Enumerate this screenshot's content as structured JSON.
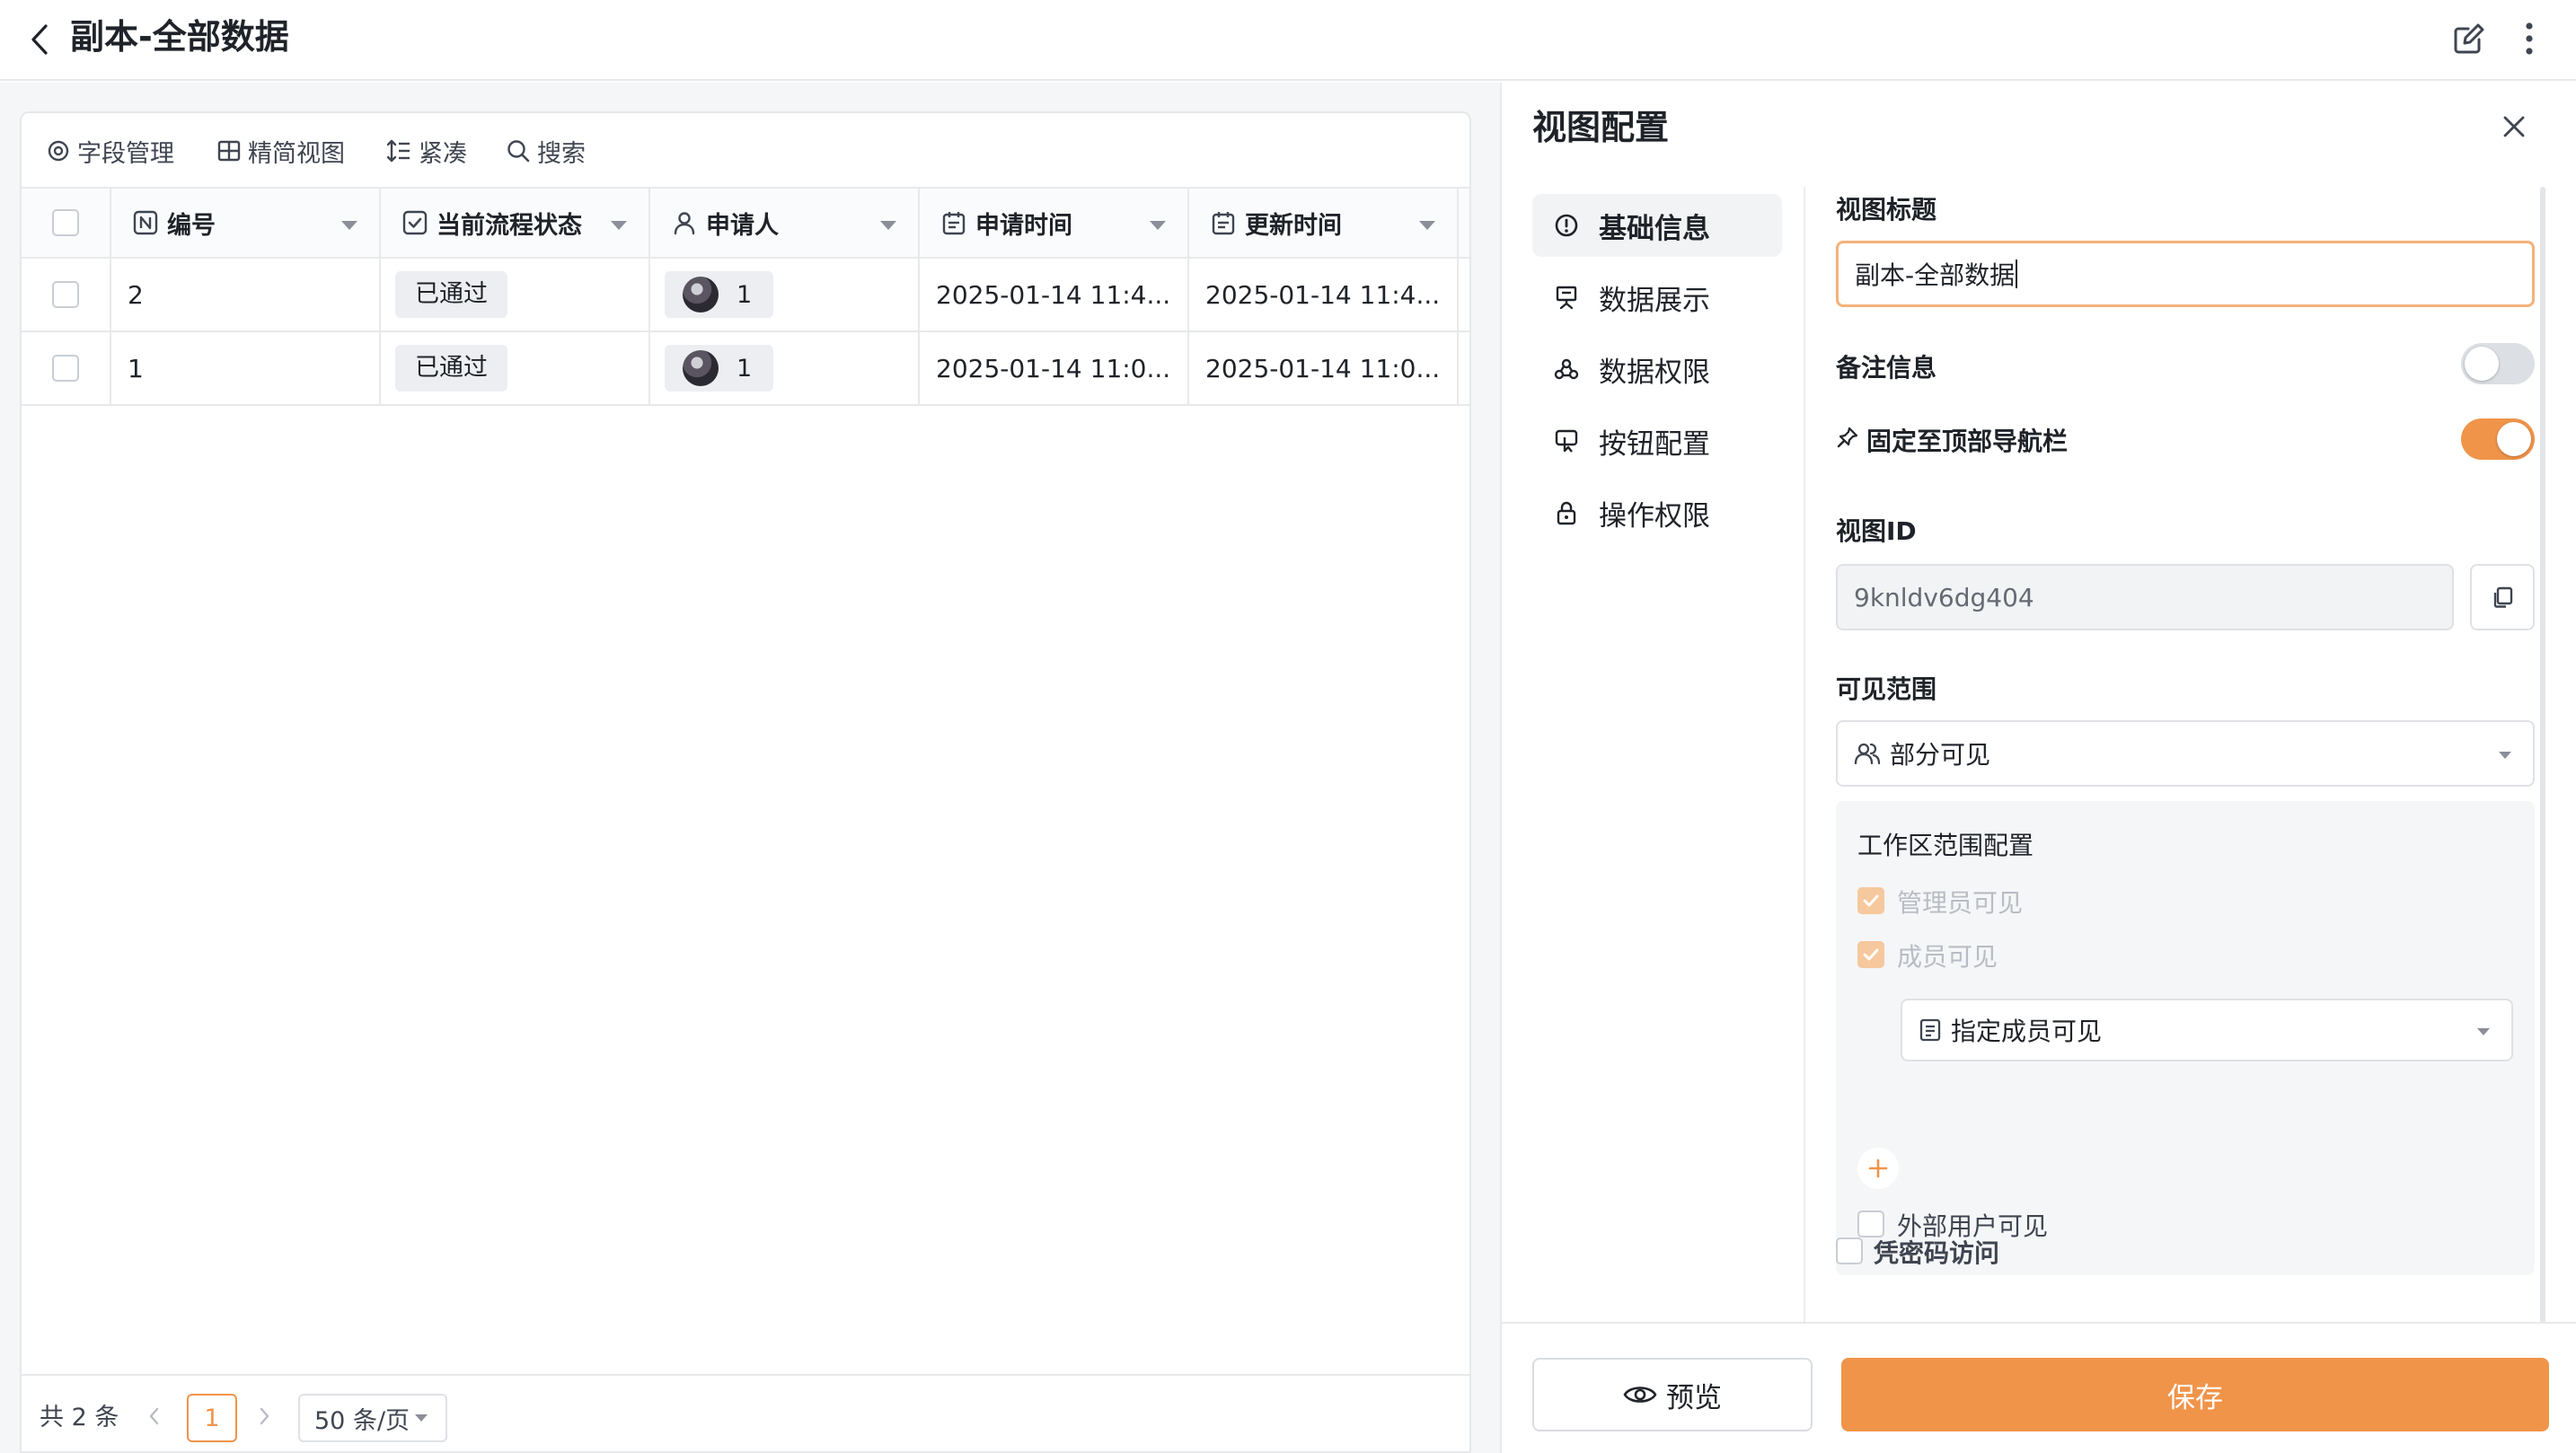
{
  "header": {
    "title": "副本-全部数据"
  },
  "toolbar": {
    "fields": "字段管理",
    "compact_view": "精简视图",
    "density": "紧凑",
    "search": "搜索"
  },
  "table": {
    "columns": [
      {
        "label": "编号",
        "icon": "number-field-icon"
      },
      {
        "label": "当前流程状态",
        "icon": "checkbox-field-icon"
      },
      {
        "label": "申请人",
        "icon": "person-field-icon"
      },
      {
        "label": "申请时间",
        "icon": "calendar-field-icon"
      },
      {
        "label": "更新时间",
        "icon": "calendar-field-icon"
      }
    ],
    "rows": [
      {
        "id": "2",
        "status": "已通过",
        "applicant": "1",
        "apply_time": "2025-01-14 11:4...",
        "update_time": "2025-01-14 11:4..."
      },
      {
        "id": "1",
        "status": "已通过",
        "applicant": "1",
        "apply_time": "2025-01-14 11:0...",
        "update_time": "2025-01-14 11:0..."
      }
    ]
  },
  "pager": {
    "total": "共 2 条",
    "current": "1",
    "page_size": "50 条/页"
  },
  "panel": {
    "title": "视图配置",
    "nav": [
      "基础信息",
      "数据展示",
      "数据权限",
      "按钮配置",
      "操作权限"
    ],
    "view_title_label": "视图标题",
    "view_title_value": "副本-全部数据",
    "remark_label": "备注信息",
    "remark_on": false,
    "pin_label": "固定至顶部导航栏",
    "pin_on": true,
    "view_id_label": "视图ID",
    "view_id_value": "9knldv6dg404",
    "visibility_label": "可见范围",
    "visibility_value": "部分可见",
    "workspace_label": "工作区范围配置",
    "admin_visible": "管理员可见",
    "member_visible": "成员可见",
    "member_select": "指定成员可见",
    "external_visible": "外部用户可见",
    "password_access": "凭密码访问",
    "preview": "预览",
    "save": "保存"
  },
  "colors": {
    "accent": "#f0944a",
    "border": "#e8e9eb",
    "toggle_off": "#dcdfe4"
  }
}
